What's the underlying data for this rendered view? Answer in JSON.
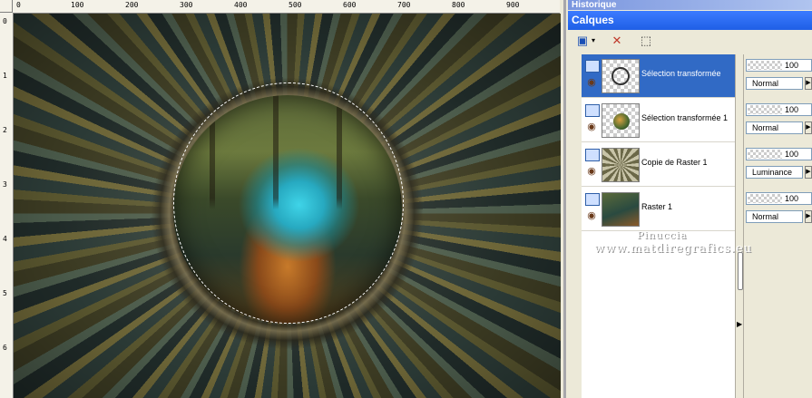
{
  "rulers": {
    "top_labels": [
      "0",
      "100",
      "200",
      "300",
      "400",
      "500",
      "600",
      "700",
      "800",
      "900"
    ],
    "left_labels": [
      "0",
      "1",
      "2",
      "3",
      "4",
      "5",
      "6"
    ]
  },
  "panels": {
    "history_title": "Historique",
    "layers_title": "Calques"
  },
  "layers": [
    {
      "name": "Sélection transformée",
      "opacity": "100",
      "blend": "Normal",
      "selected": true,
      "thumb": "ring"
    },
    {
      "name": "Sélection transformée 1",
      "opacity": "100",
      "blend": "Normal",
      "selected": false,
      "thumb": "ball"
    },
    {
      "name": "Copie de Raster 1",
      "opacity": "100",
      "blend": "Luminance",
      "selected": false,
      "thumb": "swirl"
    },
    {
      "name": "Raster 1",
      "opacity": "100",
      "blend": "Normal",
      "selected": false,
      "thumb": "forest"
    }
  ],
  "watermark": {
    "line1": "Pinuccia",
    "line2": "www.matdiregrafics.eu"
  },
  "icons": {
    "new_layer": "new-layer-icon",
    "delete_layer": "delete-layer-icon",
    "mask": "mask-icon",
    "visibility": "eye-icon"
  }
}
